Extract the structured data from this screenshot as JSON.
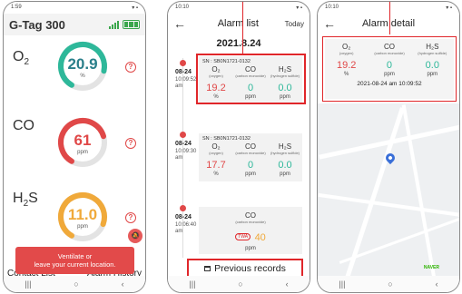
{
  "phone1": {
    "status_time": "1:59",
    "app_title": "G-Tag 300",
    "gauges": [
      {
        "gas": "O",
        "sub": "2",
        "value": "20.9",
        "unit": "%",
        "color": "#2eb89a",
        "fill": 0.7
      },
      {
        "gas": "CO",
        "sub": "",
        "value": "61",
        "unit": "ppm",
        "color": "#e04848",
        "fill": 0.62
      },
      {
        "gas": "H",
        "sub": "2",
        "gas2": "S",
        "value": "11.0",
        "unit": "ppm",
        "color": "#f0a93a",
        "fill": 0.72
      }
    ],
    "help_icon": "?",
    "ventilate_line1": "Ventilate or",
    "ventilate_line2": "leave your current location.",
    "tab_left": "Contact List",
    "tab_right": "Alarm History"
  },
  "phone2": {
    "status_time": "10:10",
    "title": "Alarm list",
    "today": "Today",
    "date_header": "2021.8.24",
    "entries": [
      {
        "date": "08-24",
        "time": "10:09:52",
        "ampm": "am",
        "sn": "SN : SB0N1721-0132",
        "gases": [
          {
            "name": "O₂",
            "desc": "(oxygen)",
            "value": "19.2",
            "unit": "%",
            "color": "#e04848"
          },
          {
            "name": "CO",
            "desc": "(carbon monoxide)",
            "value": "0",
            "unit": "ppm",
            "color": "#2eb89a"
          },
          {
            "name": "H₂S",
            "desc": "(hydrogen sulfide)",
            "value": "0.0",
            "unit": "ppm",
            "color": "#2eb89a"
          }
        ]
      },
      {
        "date": "08-24",
        "time": "10:09:30",
        "ampm": "am",
        "sn": "SN : SB0N1721-0132",
        "gases": [
          {
            "name": "O₂",
            "desc": "(oxygen)",
            "value": "17.7",
            "unit": "%",
            "color": "#e04848"
          },
          {
            "name": "CO",
            "desc": "(carbon monoxide)",
            "value": "0",
            "unit": "ppm",
            "color": "#2eb89a"
          },
          {
            "name": "H₂S",
            "desc": "(hydrogen sulfide)",
            "value": "0.0",
            "unit": "ppm",
            "color": "#2eb89a"
          }
        ]
      },
      {
        "date": "08-24",
        "time": "10:06:40",
        "ampm": "am",
        "gas_name": "CO",
        "gas_desc": "(carbon monoxide)",
        "twa": "TWA",
        "value": "40",
        "unit": "ppm",
        "color": "#f0a93a"
      }
    ],
    "prev_button": "Previous records"
  },
  "phone3": {
    "status_time": "10:10",
    "title": "Alarm detail",
    "gases": [
      {
        "name": "O₂",
        "desc": "(oxygen)",
        "value": "19.2",
        "unit": "%",
        "color": "#e04848"
      },
      {
        "name": "CO",
        "desc": "(carbon monoxide)",
        "value": "0",
        "unit": "ppm",
        "color": "#2eb89a"
      },
      {
        "name": "H₂S",
        "desc": "(hydrogen sulfide)",
        "value": "0.0",
        "unit": "ppm",
        "color": "#2eb89a"
      }
    ],
    "timestamp": "2021-08-24 am 10:09:52",
    "map_brand": "NAVER"
  }
}
